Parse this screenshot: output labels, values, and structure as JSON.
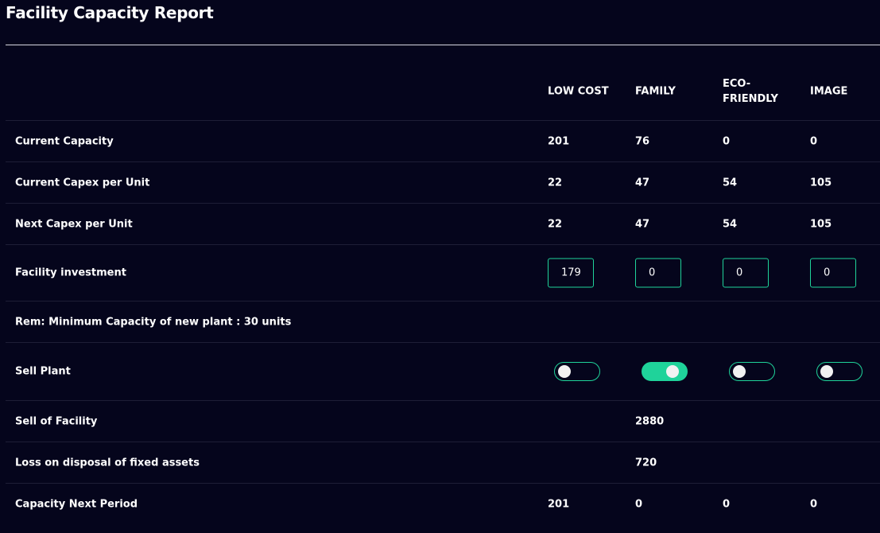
{
  "page": {
    "title": "Facility Capacity Report"
  },
  "columns": [
    "LOW COST",
    "FAMILY",
    "ECO-\nFRIENDLY",
    "IMAGE"
  ],
  "rows": {
    "current_capacity": {
      "label": "Current Capacity",
      "values": [
        "201",
        "76",
        "0",
        "0"
      ]
    },
    "current_capex": {
      "label": "Current Capex per Unit",
      "values": [
        "22",
        "47",
        "54",
        "105"
      ]
    },
    "next_capex": {
      "label": "Next Capex per Unit",
      "values": [
        "22",
        "47",
        "54",
        "105"
      ]
    },
    "facility_investment": {
      "label": "Facility investment",
      "inputs": [
        "179",
        "0",
        "0",
        "0"
      ]
    },
    "reminder": {
      "label": "Rem: Minimum Capacity of new plant : 30 units"
    },
    "sell_plant": {
      "label": "Sell Plant",
      "toggles": [
        false,
        true,
        false,
        false
      ]
    },
    "sell_of_facility": {
      "label": "Sell of Facility",
      "values": [
        "",
        "2880",
        "",
        ""
      ]
    },
    "loss_on_disposal": {
      "label": "Loss on disposal of fixed assets",
      "values": [
        "",
        "720",
        "",
        ""
      ]
    },
    "capacity_next_period": {
      "label": "Capacity Next Period",
      "values": [
        "201",
        "0",
        "0",
        "0"
      ]
    }
  },
  "colors": {
    "background": "#05051c",
    "accent": "#1fd39a",
    "divider": "#1e1e36",
    "text": "#ffffff"
  }
}
